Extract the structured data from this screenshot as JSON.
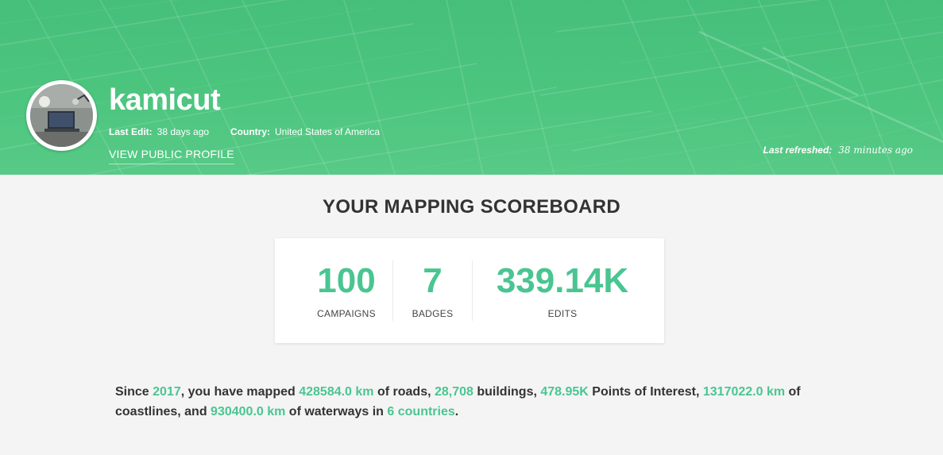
{
  "profile": {
    "username": "kamicut",
    "last_edit_label": "Last Edit:",
    "last_edit_value": "38 days ago",
    "country_label": "Country:",
    "country_value": "United States of America",
    "public_profile_link": "VIEW PUBLIC PROFILE",
    "refreshed_label": "Last refreshed:",
    "refreshed_value": "38 minutes ago"
  },
  "scoreboard": {
    "title": "YOUR MAPPING SCOREBOARD",
    "stats": [
      {
        "value": "100",
        "label": "CAMPAIGNS"
      },
      {
        "value": "7",
        "label": "BADGES"
      },
      {
        "value": "339.14K",
        "label": "EDITS"
      }
    ]
  },
  "summary": {
    "t1": "Since ",
    "year": "2017",
    "t2": ", you have mapped ",
    "roads_km": "428584.0 km",
    "t3": " of roads, ",
    "buildings": "28,708",
    "t4": " buildings, ",
    "poi": "478.95K",
    "t5": " Points of Interest, ",
    "coastlines_km": "1317022.0 km",
    "t6": " of coastlines, and ",
    "waterways_km": "930400.0 km",
    "t7": " of waterways in ",
    "countries": "6 countries",
    "t8": "."
  },
  "colors": {
    "header_green": "#4cc57f",
    "accent": "#4ac592",
    "background": "#f4f4f4"
  }
}
